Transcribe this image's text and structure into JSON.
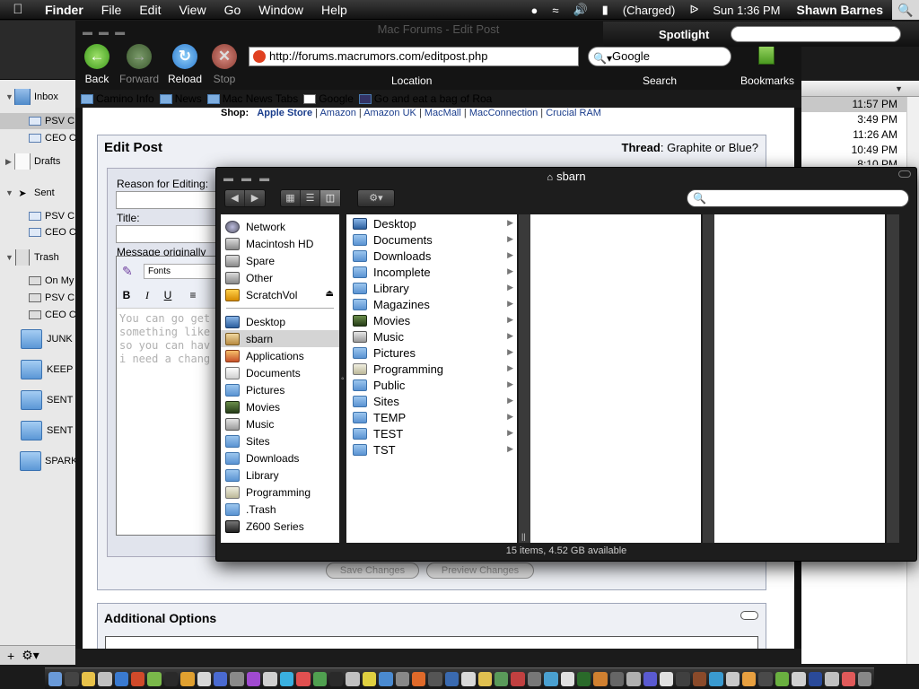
{
  "menubar": {
    "app": "Finder",
    "menus": [
      "File",
      "Edit",
      "View",
      "Go",
      "Window",
      "Help"
    ],
    "battery": "(Charged)",
    "clock": "Sun 1:36 PM",
    "user": "Shawn Barnes"
  },
  "spotlight": {
    "label": "Spotlight",
    "value": ""
  },
  "browser": {
    "title": "Mac Forums - Edit Post",
    "buttons": {
      "back": "Back",
      "forward": "Forward",
      "reload": "Reload",
      "stop": "Stop"
    },
    "url": "http://forums.macrumors.com/editpost.php",
    "search_value": "Google",
    "labels": {
      "location": "Location",
      "search": "Search",
      "bookmarks": "Bookmarks"
    },
    "bookmarks_bar": [
      "Camino Info",
      "News",
      "Mac News Tabs",
      "Google",
      "Go and eat a bag of Roa"
    ]
  },
  "webpage": {
    "shop_label": "Shop:",
    "shop_links": [
      "Apple Store",
      "Amazon",
      "Amazon UK",
      "MacMall",
      "MacConnection",
      "Crucial RAM"
    ],
    "edit_post": {
      "title": "Edit Post",
      "thread_label": "Thread",
      "thread_value": "Graphite or Blue?",
      "reason_label": "Reason for Editing:",
      "title_label": "Title:",
      "message_label": "Message originally",
      "fonts_label": "Fonts",
      "message_lines": [
        "You can go get",
        "something like",
        "so you can hav",
        "i need a chang"
      ],
      "save_button": "Save Changes",
      "preview_button": "Preview Changes"
    },
    "additional_options": "Additional Options"
  },
  "mail": {
    "sidebar": [
      {
        "label": "Inbox",
        "type": "mailbox"
      },
      {
        "label": "PSV C",
        "type": "sub",
        "selected": true
      },
      {
        "label": "CEO C",
        "type": "sub"
      },
      {
        "label": "Drafts",
        "type": "mailbox"
      },
      {
        "label": "Sent",
        "type": "mailbox"
      },
      {
        "label": "PSV C",
        "type": "sub"
      },
      {
        "label": "CEO C",
        "type": "sub"
      },
      {
        "label": "Trash",
        "type": "mailbox"
      },
      {
        "label": "On My",
        "type": "sub"
      },
      {
        "label": "PSV C",
        "type": "sub"
      },
      {
        "label": "CEO C",
        "type": "sub"
      },
      {
        "label": "JUNK",
        "type": "folder"
      },
      {
        "label": "KEEP",
        "type": "folder"
      },
      {
        "label": "SENT",
        "type": "folder"
      },
      {
        "label": "SENT",
        "type": "folder"
      },
      {
        "label": "SPARK",
        "type": "folder"
      }
    ],
    "times": [
      "11:57 PM",
      "3:49 PM",
      "11:26 AM",
      "10:49 PM",
      "8:10 PM"
    ]
  },
  "finder": {
    "title": "sbarn",
    "sidebar_devices": [
      {
        "label": "Network",
        "icon": "net"
      },
      {
        "label": "Macintosh HD",
        "icon": "drive"
      },
      {
        "label": "Spare",
        "icon": "drive"
      },
      {
        "label": "Other",
        "icon": "drive"
      },
      {
        "label": "ScratchVol",
        "icon": "scratch"
      }
    ],
    "sidebar_places": [
      {
        "label": "Desktop",
        "icon": "desk"
      },
      {
        "label": "sbarn",
        "icon": "home",
        "selected": true
      },
      {
        "label": "Applications",
        "icon": "app"
      },
      {
        "label": "Documents",
        "icon": "doc"
      },
      {
        "label": "Pictures",
        "icon": "folder"
      },
      {
        "label": "Movies",
        "icon": "movie"
      },
      {
        "label": "Music",
        "icon": "music"
      },
      {
        "label": "Sites",
        "icon": "folder"
      },
      {
        "label": "Downloads",
        "icon": "folder"
      },
      {
        "label": "Library",
        "icon": "folder"
      },
      {
        "label": "Programming",
        "icon": "prog"
      },
      {
        "label": ".Trash",
        "icon": "folder"
      },
      {
        "label": "Z600 Series",
        "icon": "print"
      }
    ],
    "column1": [
      "Desktop",
      "Documents",
      "Downloads",
      "Incomplete",
      "Library",
      "Magazines",
      "Movies",
      "Music",
      "Pictures",
      "Programming",
      "Public",
      "Sites",
      "TEMP",
      "TEST",
      "TST"
    ],
    "status": "15 items, 4.52 GB available"
  }
}
